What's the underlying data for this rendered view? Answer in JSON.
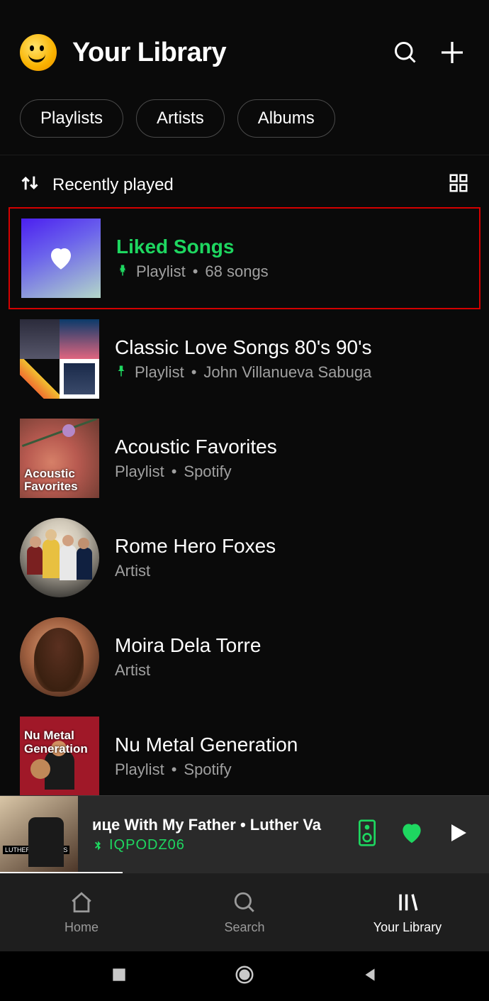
{
  "header": {
    "title": "Your Library"
  },
  "chips": [
    "Playlists",
    "Artists",
    "Albums"
  ],
  "sort": {
    "label": "Recently played"
  },
  "items": [
    {
      "title": "Liked Songs",
      "sub_prefix": "Playlist",
      "sub_suffix": "68 songs",
      "pinned": true,
      "accent": true,
      "highlight": true,
      "thumb": "liked"
    },
    {
      "title": "Classic Love Songs 80's 90's",
      "sub_prefix": "Playlist",
      "sub_suffix": "John Villanueva Sabuga",
      "pinned": true,
      "thumb": "collage"
    },
    {
      "title": "Acoustic Favorites",
      "sub_prefix": "Playlist",
      "sub_suffix": "Spotify",
      "thumb": "acoustic"
    },
    {
      "title": "Rome Hero Foxes",
      "sub_prefix": "Artist",
      "thumb": "band",
      "round": true
    },
    {
      "title": "Moira Dela Torre",
      "sub_prefix": "Artist",
      "thumb": "moira",
      "round": true
    },
    {
      "title": "Nu Metal Generation",
      "sub_prefix": "Playlist",
      "sub_suffix": "Spotify",
      "thumb": "numetal"
    }
  ],
  "nowplaying": {
    "title": "ице With My Father • Luther Va",
    "device": "IQPODZ06",
    "art_label": "LUTHER VANDROSS"
  },
  "tabs": [
    {
      "label": "Home"
    },
    {
      "label": "Search"
    },
    {
      "label": "Your Library",
      "active": true
    }
  ],
  "thumb_overlays": {
    "acoustic": "Acoustic Favorites",
    "numetal": "Nu Metal Generation"
  }
}
